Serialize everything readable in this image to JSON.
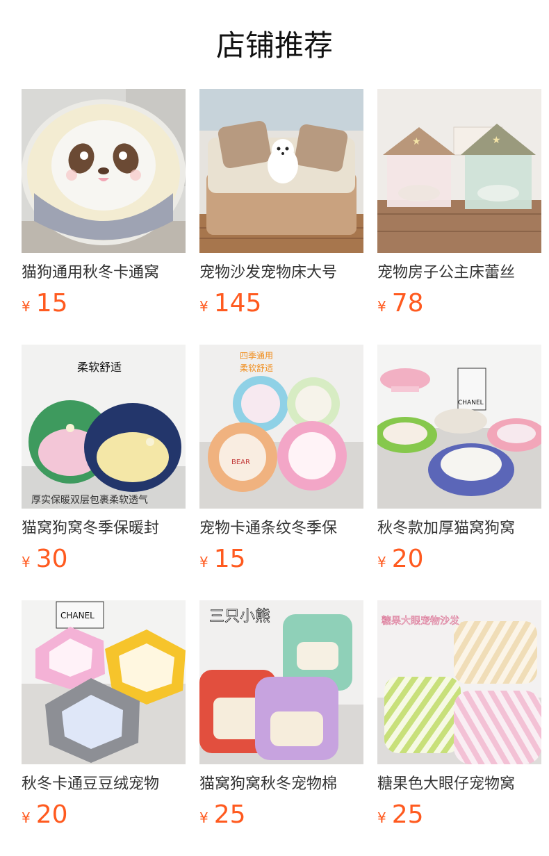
{
  "page": {
    "title": "店铺推荐"
  },
  "accent_color": "#ff5a1f",
  "currency_symbol": "¥",
  "products": [
    {
      "name": "猫狗通用秋冬卡通窝",
      "price": "15",
      "image": "panda-face-round-bed"
    },
    {
      "name": "宠物沙发宠物床大号",
      "price": "145",
      "image": "pet-sofa-bed"
    },
    {
      "name": "宠物房子公主床蕾丝",
      "price": "78",
      "image": "princess-house-bed"
    },
    {
      "name": "猫窝狗窝冬季保暖封",
      "price": "30",
      "image": "closed-shell-bed",
      "overlay": [
        "柔软舒适",
        "厚实保暖双层包裹柔软透气"
      ]
    },
    {
      "name": "宠物卡通条纹冬季保",
      "price": "15",
      "image": "striped-round-beds",
      "overlay": [
        "四季通用",
        "柔软舒适"
      ]
    },
    {
      "name": "秋冬款加厚猫窝狗窝",
      "price": "20",
      "image": "thick-round-beds",
      "overlay": [
        "CHANEL"
      ]
    },
    {
      "name": "秋冬卡通豆豆绒宠物",
      "price": "20",
      "image": "hexagon-plush-beds",
      "overlay": [
        "CHANEL"
      ]
    },
    {
      "name": "猫窝狗窝秋冬宠物棉",
      "price": "25",
      "image": "bear-sofa-beds",
      "overlay": [
        "三只小熊"
      ]
    },
    {
      "name": "糖果色大眼仔宠物窝",
      "price": "25",
      "image": "candy-stripe-beds",
      "overlay": [
        "糖果大眼宠物沙发"
      ]
    }
  ]
}
